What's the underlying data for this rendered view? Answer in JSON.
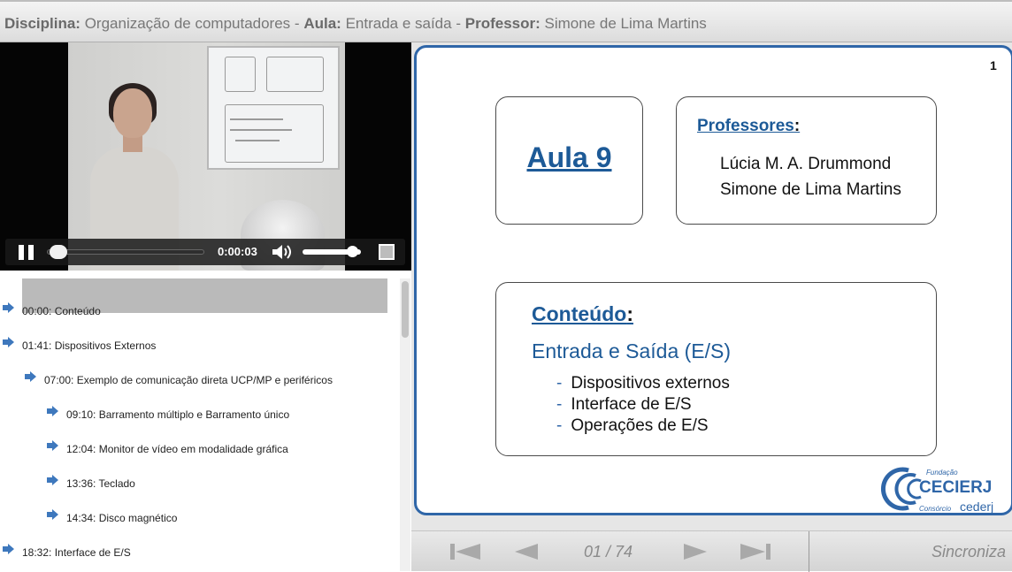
{
  "header": {
    "disciplina_label": "Disciplina:",
    "disciplina_value": "Organização de computadores",
    "aula_label": "Aula:",
    "aula_value": "Entrada e saída",
    "professor_label": "Professor:",
    "professor_value": "Simone de Lima Martins",
    "separator": "-"
  },
  "player": {
    "time": "0:00:03",
    "progress_fraction": 0.02,
    "volume_fraction": 0.9,
    "icons": {
      "play_pause": "pause-icon",
      "volume": "volume-icon",
      "fullscreen": "fullscreen-icon"
    }
  },
  "toc": {
    "items": [
      {
        "label": "00:00: Conteúdo",
        "level": 0,
        "active": true
      },
      {
        "label": "01:41: Dispositivos Externos",
        "level": 0,
        "active": false
      },
      {
        "label": "07:00: Exemplo de comunicação direta UCP/MP e periféricos",
        "level": 1,
        "active": false
      },
      {
        "label": "09:10: Barramento múltiplo e Barramento único",
        "level": 2,
        "active": false
      },
      {
        "label": "12:04: Monitor de vídeo em modalidade gráfica",
        "level": 2,
        "active": false
      },
      {
        "label": "13:36: Teclado",
        "level": 2,
        "active": false
      },
      {
        "label": "14:34: Disco magnético",
        "level": 2,
        "active": false
      },
      {
        "label": "18:32: Interface de E/S",
        "level": 0,
        "active": false
      }
    ],
    "icon": "arrow-right-icon"
  },
  "slide": {
    "page": "1",
    "aula": "Aula 9",
    "professores_label": "Professores",
    "colon": ":",
    "professores": [
      "Lúcia M. A. Drummond",
      "Simone de Lima Martins"
    ],
    "conteudo_label": "Conteúdo",
    "conteudo_subtitle": "Entrada e Saída (E/S)",
    "bullet": "-",
    "conteudo_items": [
      "Dispositivos externos",
      "Interface de E/S",
      "Operações de E/S"
    ],
    "logo": {
      "top": "Fundação",
      "main": "CECIERJ",
      "bottom": "Consórcio",
      "brand": "cederj"
    },
    "accent": "#1d5a97",
    "border_color": "#2f66a8"
  },
  "nav": {
    "pager": "01 / 74",
    "sync": "Sincroniza",
    "icons": [
      "first-page-icon",
      "prev-page-icon",
      "next-page-icon",
      "last-page-icon"
    ]
  }
}
